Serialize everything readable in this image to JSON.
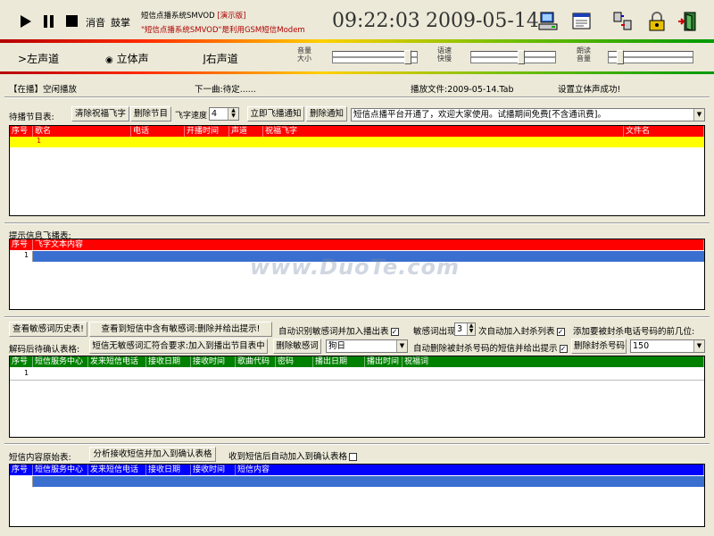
{
  "top": {
    "mute": "消音",
    "drum": "鼓掌",
    "title1": "短信点播系统SMVOD",
    "demo": "[演示版]",
    "title2": "\"短信点播系统SMVOD\"是利用GSM短信Modem",
    "time": "09:22:03",
    "date": "2009-05-14"
  },
  "channels": {
    "left": "左声道",
    "stereo": "立体声",
    "right": "右声道"
  },
  "sliders": {
    "volume": {
      "label": "音量\n大小",
      "value": 0.93
    },
    "speed": {
      "label": "语速\n快慢",
      "value": 0.6
    },
    "vol2": {
      "label": "朗读\n音量",
      "value": 0.1
    }
  },
  "status": {
    "playing": "【在播】空闲播放",
    "next": "下一曲:待定......",
    "file": "播放文件:2009-05-14.Tab",
    "msg": "设置立体声成功!"
  },
  "pending": {
    "label": "待播节目表:",
    "clear_btn": "清除祝福飞字",
    "del_btn": "删除节目",
    "level_label": "飞字速度",
    "level_value": "4",
    "notify_btn": "立即飞播通知",
    "del_notify_btn": "删除通知",
    "notice": "短信点播平台开通了，欢迎大家使用。试播期间免费[不含通讯费]。",
    "columns": [
      "序号",
      "歌名",
      "电话",
      "开播时间",
      "声道",
      "祝福飞字",
      "文件名"
    ],
    "row_num": "1"
  },
  "tips": {
    "label": "提示信息飞播表:",
    "columns": [
      "序号",
      "飞字文本内容"
    ],
    "row_num": "1"
  },
  "sensitive": {
    "history_btn": "查看敏感词历史表!",
    "check_btn": "查看到短信中含有敏感词:删除并给出提示!",
    "auto_label": "自动识别敏感词并加入播出表",
    "count_label": "敏感词出现",
    "count_value": "3",
    "count_suffix": "次自动加入封杀列表",
    "prefix_label": "添加要被封杀电话号码的前几位:",
    "confirm_label": "解码后待确认表格:",
    "nosens_btn": "短信无敏感词汇符合要求:加入到播出节目表中",
    "del_sens_btn": "删除敏感词",
    "combo_value": "狗日",
    "auto_del_label": "自动删除被封杀号码的短信并给出提示",
    "del_number_btn": "删除封杀号码",
    "number_value": "150",
    "columns": [
      "序号",
      "短信服务中心",
      "发来短信电话",
      "接收日期",
      "接收时间",
      "歌曲代码",
      "密码",
      "播出日期",
      "播出时间",
      "祝福词"
    ],
    "row_num": "1"
  },
  "raw": {
    "label": "短信内容原始表:",
    "analyze_btn": "分析接收短信并加入到确认表格",
    "auto_label": "收到短信后自动加入到确认表格",
    "columns": [
      "序号",
      "短信服务中心",
      "发来短信电话",
      "接收日期",
      "接收时间",
      "短信内容"
    ]
  },
  "colors": {
    "red": "#ff0000",
    "yellow": "#ffff00",
    "blue": "#0000ff",
    "selblue": "#3a6fd0",
    "green": "#008000"
  }
}
